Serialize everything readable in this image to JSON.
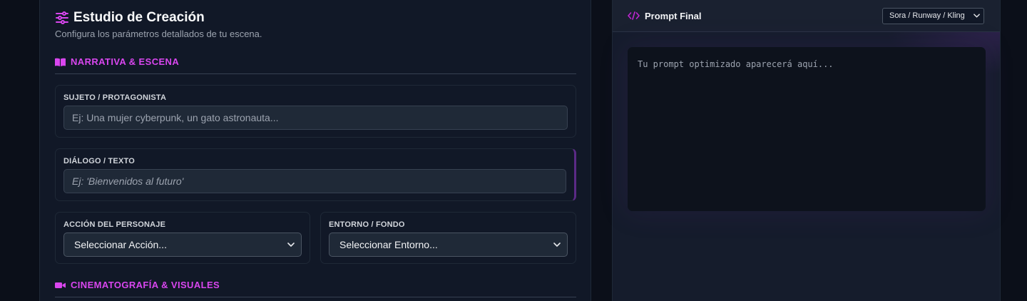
{
  "studio": {
    "title": "Estudio de Creación",
    "subtitle": "Configura los parámetros detallados de tu escena."
  },
  "sections": {
    "narrative": {
      "heading": "NARRATIVA & ESCENA",
      "icon": "book-icon"
    },
    "cinematography": {
      "heading": "CINEMATOGRAFÍA & VISUALES",
      "icon": "video-camera-icon"
    }
  },
  "fields": {
    "subject": {
      "label": "SUJETO / PROTAGONISTA",
      "placeholder": "Ej: Una mujer cyberpunk, un gato astronauta..."
    },
    "dialogue": {
      "label": "DIÁLOGO / TEXTO",
      "placeholder": "Ej: 'Bienvenidos al futuro'"
    },
    "action": {
      "label": "ACCIÓN DEL PERSONAJE",
      "selected": "Seleccionar Acción..."
    },
    "environment": {
      "label": "ENTORNO / FONDO",
      "selected": "Seleccionar Entorno..."
    }
  },
  "output": {
    "title": "Prompt Final",
    "model_selected": "Sora / Runway / Kling",
    "placeholder": "Tu prompt optimizado aparecerá aquí..."
  },
  "colors": {
    "accent": "#d946ef",
    "background": "#0b0f19",
    "panel": "#111827"
  }
}
